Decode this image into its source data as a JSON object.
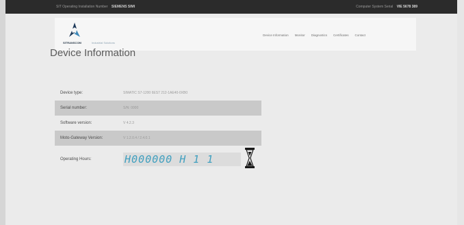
{
  "topbar": {
    "left_text": "SIT Operating Installation Number",
    "left_value": "SIEMENS SIMI",
    "right_text": "Computer System Serial",
    "right_value": "VIE 5678 389"
  },
  "header": {
    "brand": "SITRANSCOM",
    "brand_sub": "Industrial Solutions"
  },
  "nav": {
    "items": [
      "Device Information",
      "Monitor",
      "Diagnostics",
      "Certificates",
      "Contact"
    ]
  },
  "page": {
    "title": "Device Information"
  },
  "device": {
    "rows": [
      {
        "label": "Device type:",
        "value": "SIMATIC S7-1200 6ES7 212-1AE40-0XB0"
      },
      {
        "label": "Serial number:",
        "value": "S/N: 0000"
      },
      {
        "label": "Software version:",
        "value": "V 4.2.3"
      },
      {
        "label": "Moto-Gateway Version:",
        "value": "V 1.2.0.4 / 2.4.0.1"
      }
    ],
    "hours_label": "Operating Hours:",
    "hours_value": "H000000 H 1 1"
  },
  "colors": {
    "topbar": "#2b2b2b",
    "lcd_digits": "#3f9fbf",
    "row_alt": "#c9c9c9"
  },
  "icons": {
    "logo": "tri-arrow-logo-icon",
    "hours": "hourglass-icon"
  }
}
